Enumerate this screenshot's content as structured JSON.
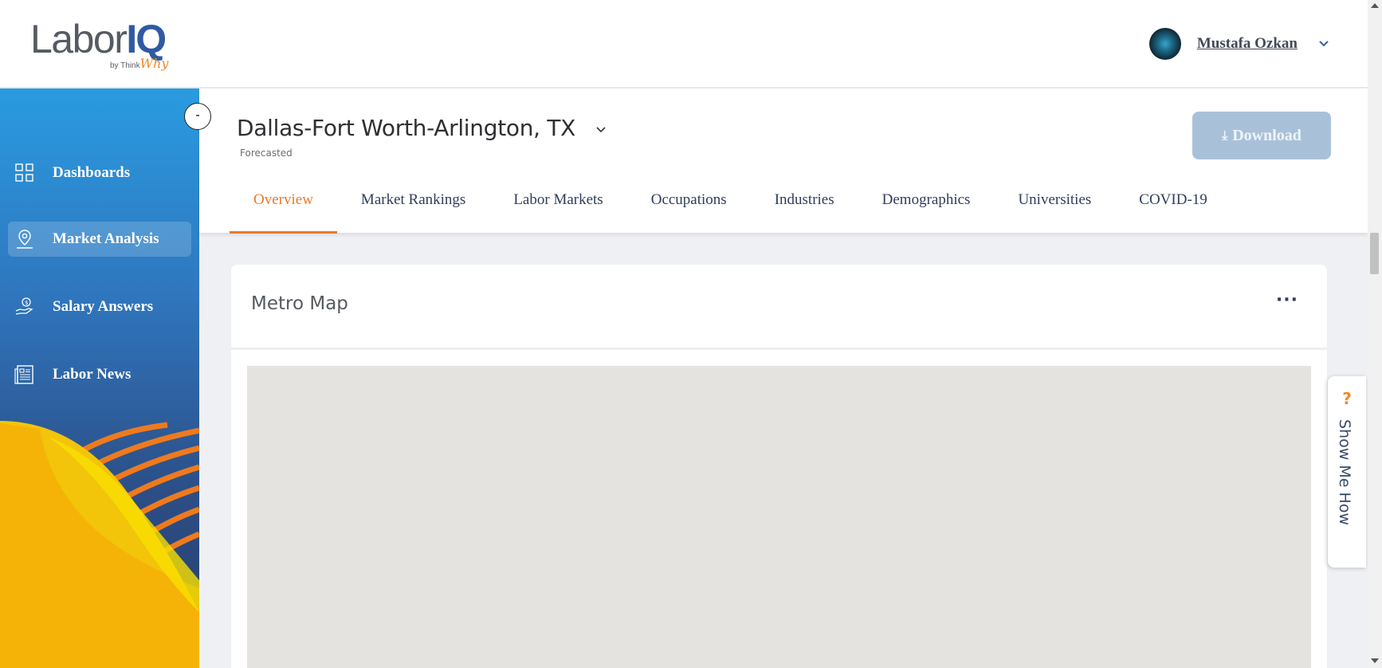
{
  "brand": {
    "logo_text": "LaborIQ",
    "logo_prefix": "Labor",
    "logo_suffix": "IQ",
    "byline_by": "by Think",
    "byline_why": "Why"
  },
  "user": {
    "name": "Mustafa Ozkan"
  },
  "sidebar": {
    "collapse_label": "-",
    "items": [
      {
        "label": "Dashboards",
        "icon": "dashboard-grid-icon",
        "active": false
      },
      {
        "label": "Market Analysis",
        "icon": "map-pin-icon",
        "active": true
      },
      {
        "label": "Salary Answers",
        "icon": "hand-money-icon",
        "active": false
      },
      {
        "label": "Labor News",
        "icon": "newspaper-icon",
        "active": false
      }
    ]
  },
  "header": {
    "metro": "Dallas-Fort Worth-Arlington, TX",
    "subtitle": "Forecasted",
    "download_label": "Download",
    "download_icon": "download-icon",
    "tabs": [
      {
        "label": "Overview",
        "active": true
      },
      {
        "label": "Market Rankings"
      },
      {
        "label": "Labor Markets"
      },
      {
        "label": "Occupations"
      },
      {
        "label": "Industries"
      },
      {
        "label": "Demographics"
      },
      {
        "label": "Universities"
      },
      {
        "label": "COVID-19"
      }
    ]
  },
  "card": {
    "title": "Metro Map",
    "menu": "···"
  },
  "help": {
    "icon": "?",
    "label": "Show Me How"
  },
  "colors": {
    "accent": "#ec7a25",
    "sidebar_top": "#2a9be0",
    "sidebar_bottom": "#263d6b",
    "download_bg": "#a9c1d8"
  }
}
